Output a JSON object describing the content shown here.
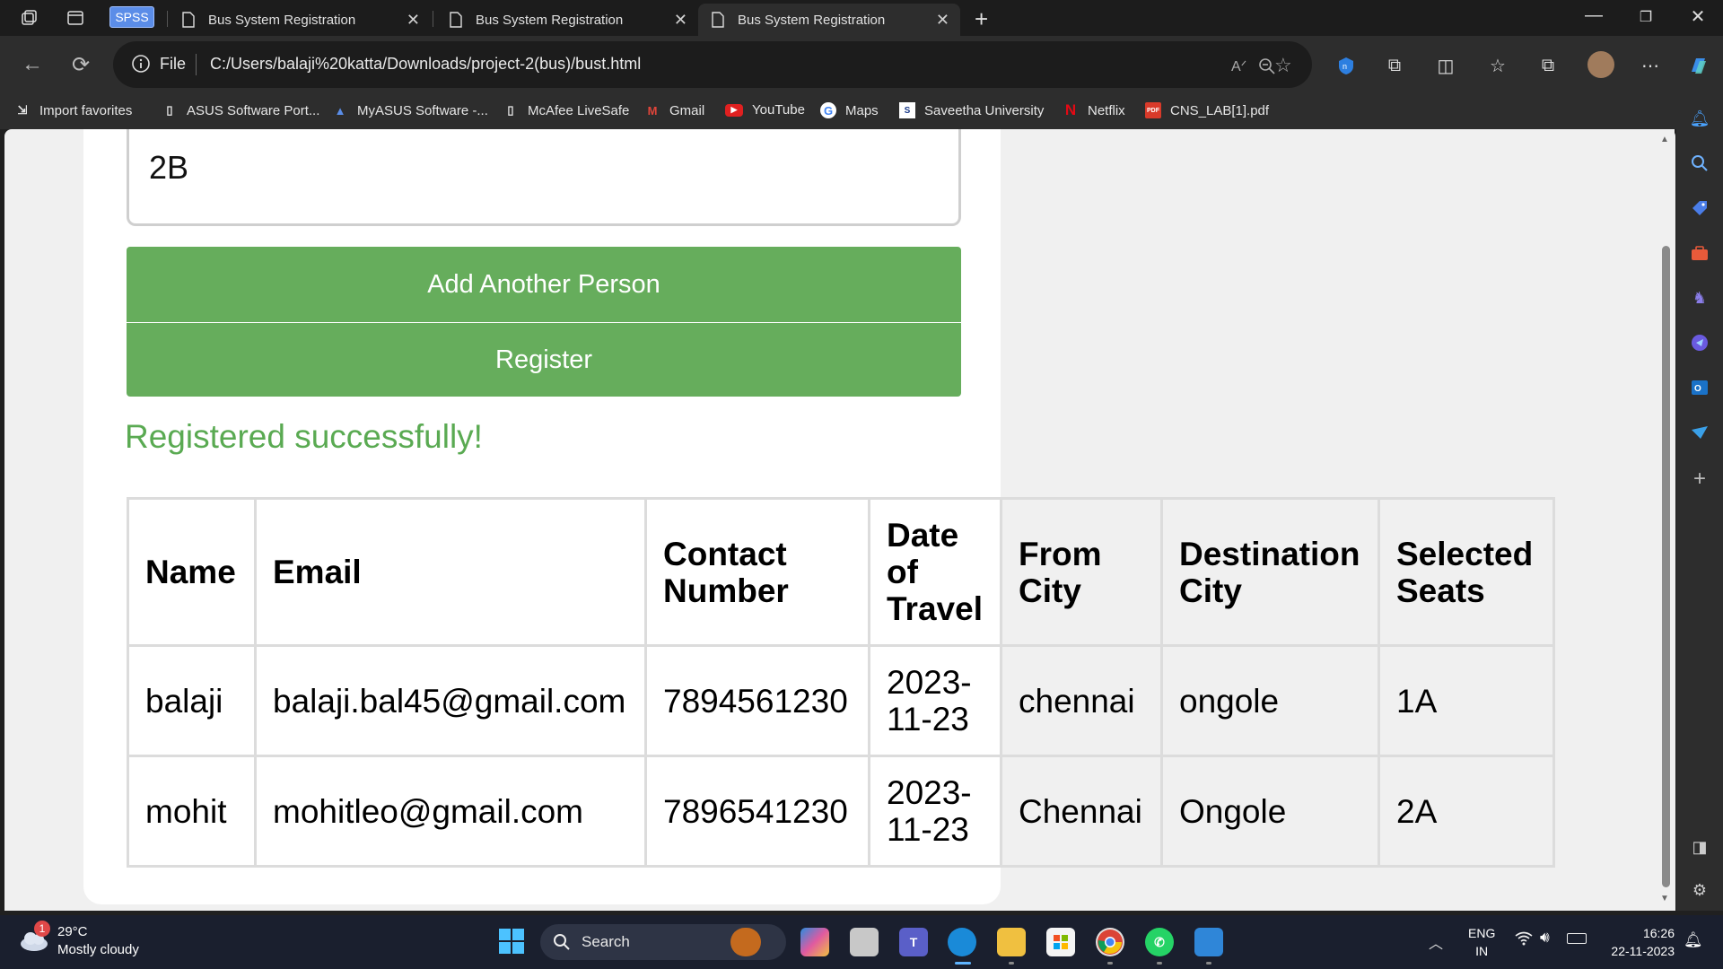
{
  "browser": {
    "spss_label": "SPSS",
    "tabs": [
      {
        "title": "Bus System Registration"
      },
      {
        "title": "Bus System Registration"
      },
      {
        "title": "Bus System Registration"
      }
    ],
    "address": {
      "scheme_label": "File",
      "url": "C:/Users/balaji%20katta/Downloads/project-2(bus)/bust.html"
    },
    "favorites": [
      {
        "label": "Import favorites"
      },
      {
        "label": "ASUS Software Port..."
      },
      {
        "label": "MyASUS Software -..."
      },
      {
        "label": "McAfee LiveSafe"
      },
      {
        "label": "Gmail"
      },
      {
        "label": "YouTube"
      },
      {
        "label": "Maps"
      },
      {
        "label": "Saveetha University"
      },
      {
        "label": "Netflix"
      },
      {
        "label": "CNS_LAB[1].pdf"
      }
    ]
  },
  "form": {
    "seat_value": "2B",
    "add_button": "Add Another Person",
    "register_button": "Register",
    "success_message": "Registered successfully!"
  },
  "table": {
    "headers": [
      "Name",
      "Email",
      "Contact Number",
      "Date of Travel",
      "From City",
      "Destination City",
      "Selected Seats"
    ],
    "rows": [
      [
        "balaji",
        "balaji.bal45@gmail.com",
        "7894561230",
        "2023-11-23",
        "chennai",
        "ongole",
        "1A"
      ],
      [
        "mohit",
        "mohitleo@gmail.com",
        "7896541230",
        "2023-11-23",
        "Chennai",
        "Ongole",
        "2A"
      ]
    ]
  },
  "taskbar": {
    "weather_badge": "1",
    "temperature": "29°C",
    "condition": "Mostly cloudy",
    "search_label": "Search",
    "lang_top": "ENG",
    "lang_bottom": "IN",
    "time": "16:26",
    "date": "22-11-2023"
  },
  "colors": {
    "button_green": "#66ad5c",
    "success_green": "#5aaa52",
    "page_background": "#f0f0f0"
  }
}
